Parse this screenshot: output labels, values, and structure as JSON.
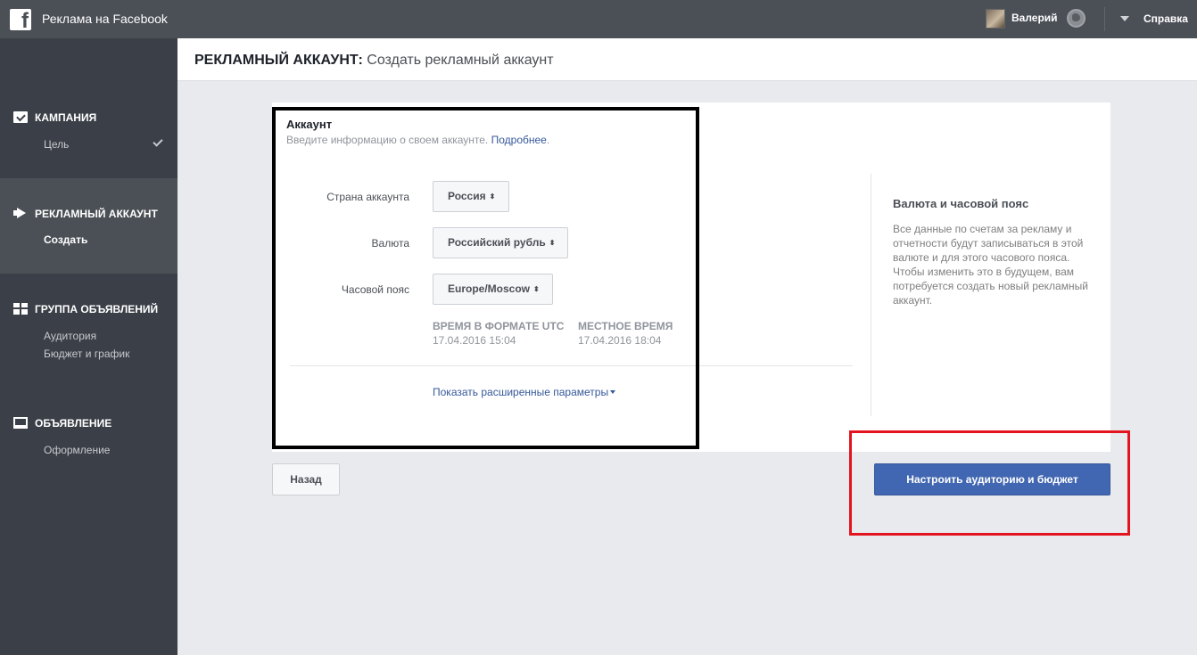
{
  "topbar": {
    "logo": "f",
    "app_title": "Реклама на Facebook",
    "user_name": "Валерий",
    "help_label": "Справка"
  },
  "sidebar": {
    "sections": [
      {
        "label": "КАМПАНИЯ",
        "icon": "campaign-icon",
        "items": [
          "Цель"
        ]
      },
      {
        "label": "РЕКЛАМНЫЙ АККАУНТ",
        "icon": "megaphone-icon",
        "items": [
          "Создать"
        ]
      },
      {
        "label": "ГРУППА ОБЪЯВЛЕНИЙ",
        "icon": "grid-icon",
        "items": [
          "Аудитория",
          "Бюджет и график"
        ]
      },
      {
        "label": "ОБЪЯВЛЕНИЕ",
        "icon": "monitor-icon",
        "items": [
          "Оформление"
        ]
      }
    ]
  },
  "header": {
    "title_bold": "РЕКЛАМНЫЙ АККАУНТ:",
    "title_rest": " Создать рекламный аккаунт"
  },
  "account": {
    "title": "Аккаунт",
    "description": "Введите информацию о своем аккаунте. ",
    "learn_more": "Подробнее",
    "period": ".",
    "fields": {
      "country_label": "Страна аккаунта",
      "country_value": "Россия",
      "currency_label": "Валюта",
      "currency_value": "Российский рубль",
      "timezone_label": "Часовой пояс",
      "timezone_value": "Europe/Moscow"
    },
    "utc_label": "ВРЕМЯ В ФОРМАТЕ UTC",
    "utc_value": "17.04.2016 15:04",
    "local_label": "МЕСТНОЕ ВРЕМЯ",
    "local_value": "17.04.2016 18:04",
    "advanced_link": "Показать расширенные параметры"
  },
  "info": {
    "title": "Валюта и часовой пояс",
    "text": "Все данные по счетам за рекламу и отчетности будут записываться в этой валюте и для этого часового пояса. Чтобы изменить это в будущем, вам потребуется создать новый рекламный аккаунт."
  },
  "buttons": {
    "back": "Назад",
    "next": "Настроить аудиторию и бюджет"
  },
  "colors": {
    "topbar": "#4b4f56",
    "sidebar": "#3b3f47",
    "primary": "#4267b2",
    "highlight_red": "#e3141f",
    "highlight_black": "#000000"
  }
}
